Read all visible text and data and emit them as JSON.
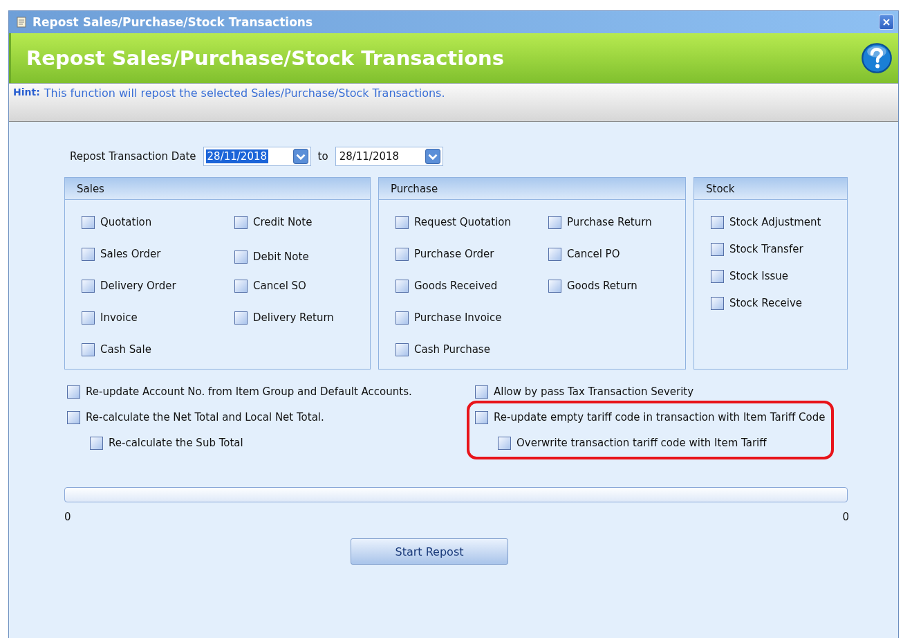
{
  "window": {
    "title": "Repost Sales/Purchase/Stock Transactions"
  },
  "header": {
    "title": "Repost Sales/Purchase/Stock Transactions"
  },
  "hint": {
    "label": "Hint:",
    "text": "This function will repost the selected Sales/Purchase/Stock Transactions."
  },
  "date_range": {
    "label": "Repost Transaction Date",
    "from": {
      "value": "28/11/2018",
      "text_selected": true
    },
    "separator": "to",
    "to": {
      "value": "28/11/2018",
      "text_selected": false
    }
  },
  "groups": [
    {
      "title": "Sales",
      "columns": [
        [
          {
            "label": "Quotation",
            "checked": false
          },
          {
            "label": "Sales Order",
            "checked": false
          },
          {
            "label": "Delivery Order",
            "checked": false
          },
          {
            "label": "Invoice",
            "checked": false
          },
          {
            "label": "Cash Sale",
            "checked": false
          }
        ],
        [
          {
            "label": "Credit Note",
            "checked": false
          },
          {
            "label": "Debit Note",
            "checked": false
          },
          {
            "label": "Cancel SO",
            "checked": false
          },
          {
            "label": "Delivery Return",
            "checked": false
          }
        ]
      ]
    },
    {
      "title": "Purchase",
      "columns": [
        [
          {
            "label": "Request Quotation",
            "checked": false
          },
          {
            "label": "Purchase Order",
            "checked": false
          },
          {
            "label": "Goods Received",
            "checked": false
          },
          {
            "label": "Purchase Invoice",
            "checked": false
          },
          {
            "label": "Cash Purchase",
            "checked": false
          }
        ],
        [
          {
            "label": "Purchase Return",
            "checked": false
          },
          {
            "label": "Cancel PO",
            "checked": false
          },
          {
            "label": "Goods Return",
            "checked": false
          }
        ]
      ]
    },
    {
      "title": "Stock",
      "columns": [
        [
          {
            "label": "Stock Adjustment",
            "checked": false
          },
          {
            "label": "Stock Transfer",
            "checked": false
          },
          {
            "label": "Stock Issue",
            "checked": false
          },
          {
            "label": "Stock Receive",
            "checked": false
          }
        ]
      ]
    }
  ],
  "options": [
    [
      {
        "label": "Re-update Account No. from Item Group and Default Accounts.",
        "checked": false,
        "highlighted": false
      },
      {
        "label": "Re-calculate the Net Total and Local Net Total.",
        "checked": false,
        "highlighted": false,
        "children": [
          {
            "label": "Re-calculate the Sub Total",
            "checked": false
          }
        ]
      }
    ],
    [
      {
        "label": "Allow by pass Tax Transaction Severity",
        "checked": false,
        "highlighted": false
      },
      {
        "label": "Re-update empty tariff code in transaction with Item Tariff Code",
        "checked": false,
        "highlighted": true,
        "children": [
          {
            "label": "Overwrite transaction tariff code with Item Tariff",
            "checked": false
          }
        ]
      }
    ]
  ],
  "progress": {
    "level": 0,
    "min_label": "0",
    "max_label": "0"
  },
  "buttons": [
    "Start Repost"
  ]
}
